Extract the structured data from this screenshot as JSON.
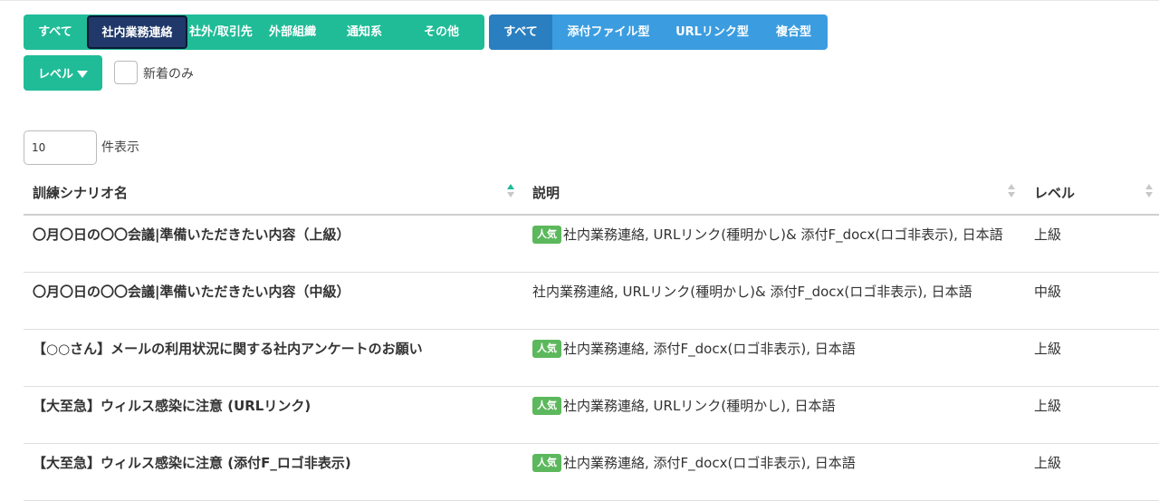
{
  "filters": {
    "category": [
      {
        "label": "すべて",
        "active": false
      },
      {
        "label": "社内業務連絡",
        "active": true
      },
      {
        "label": "社外/取引先",
        "active": false
      },
      {
        "label": "外部組織",
        "active": false
      },
      {
        "label": "通知系",
        "active": false
      },
      {
        "label": "その他",
        "active": false
      }
    ],
    "type": [
      {
        "label": "すべて",
        "active": true
      },
      {
        "label": "添付ファイル型",
        "active": false
      },
      {
        "label": "URLリンク型",
        "active": false
      },
      {
        "label": "複合型",
        "active": false
      }
    ],
    "level_label": "レベル",
    "new_only_label": "新着のみ",
    "new_only_checked": false
  },
  "page_length": {
    "value": "10",
    "suffix": "件表示"
  },
  "colors": {
    "category_group": "#1fbc97",
    "category_active": "#20386a",
    "type_group": "#3b9de0",
    "type_active": "#2a7fc0",
    "popular_badge": "#5cb85c"
  },
  "table": {
    "headers": {
      "name": "訓練シナリオ名",
      "description": "説明",
      "level": "レベル"
    },
    "sorted_column": "name",
    "rows": [
      {
        "name": "〇月〇日の〇〇会議|準備いただきたい内容（上級）",
        "badge": "人気",
        "description": "社内業務連絡, URLリンク(種明かし)& 添付F_docx(ロゴ非表示), 日本語",
        "level": "上級"
      },
      {
        "name": "〇月〇日の〇〇会議|準備いただきたい内容（中級）",
        "badge": "",
        "description": "社内業務連絡, URLリンク(種明かし)& 添付F_docx(ロゴ非表示), 日本語",
        "level": "中級"
      },
      {
        "name": "【○○さん】メールの利用状況に関する社内アンケートのお願い",
        "badge": "人気",
        "description": "社内業務連絡, 添付F_docx(ロゴ非表示), 日本語",
        "level": "上級"
      },
      {
        "name": "【大至急】ウィルス感染に注意 (URLリンク)",
        "badge": "人気",
        "description": "社内業務連絡, URLリンク(種明かし), 日本語",
        "level": "上級"
      },
      {
        "name": "【大至急】ウィルス感染に注意 (添付F_ロゴ非表示)",
        "badge": "人気",
        "description": "社内業務連絡, 添付F_docx(ロゴ非表示), 日本語",
        "level": "上級"
      }
    ]
  }
}
